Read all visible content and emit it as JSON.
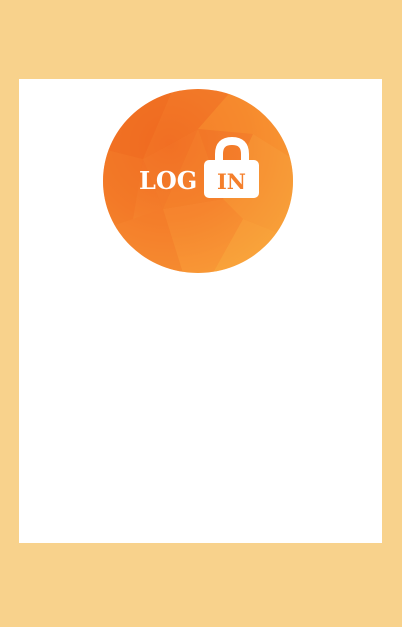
{
  "colors": {
    "page_background": "#f8d28c",
    "card_background": "#ffffff",
    "logo_orange_dark": "#f06a22",
    "logo_orange_mid": "#f47f2b",
    "logo_orange_light": "#f8a23a",
    "logo_text": "#ffffff"
  },
  "login_logo": {
    "left_text": "LOG",
    "right_text": "IN",
    "icon": "padlock-icon"
  }
}
